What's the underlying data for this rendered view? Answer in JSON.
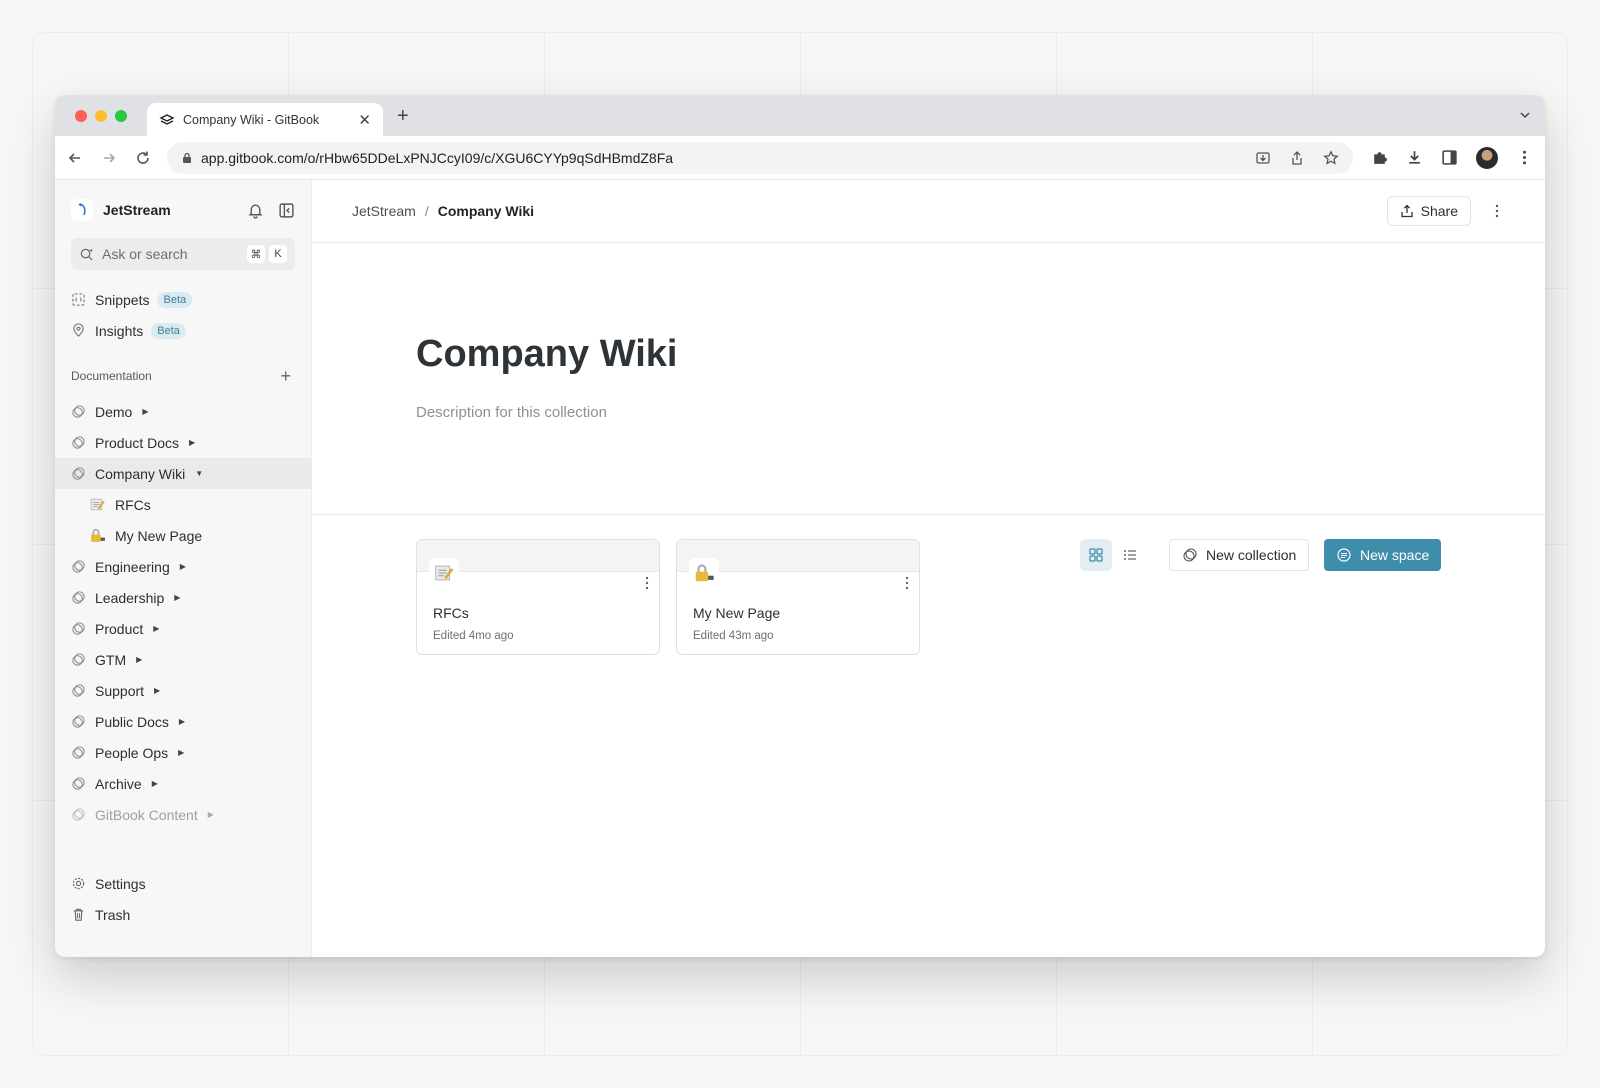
{
  "browser": {
    "tab_title": "Company Wiki - GitBook",
    "url": "app.gitbook.com/o/rHbw65DDeLxPNJCcyI09/c/XGU6CYYp9qSdHBmdZ8Fa",
    "traffic_colors": [
      "#fe5f57",
      "#febc2e",
      "#28c840"
    ]
  },
  "sidebar": {
    "org_name": "JetStream",
    "search_placeholder": "Ask or search",
    "search_kbd": [
      "⌘",
      "K"
    ],
    "top_items": [
      {
        "label": "Snippets",
        "badge": "Beta"
      },
      {
        "label": "Insights",
        "badge": "Beta"
      }
    ],
    "section_title": "Documentation",
    "tree": [
      {
        "label": "Demo"
      },
      {
        "label": "Product Docs"
      },
      {
        "label": "Company Wiki"
      },
      {
        "label": "RFCs"
      },
      {
        "label": "My New Page"
      },
      {
        "label": "Engineering"
      },
      {
        "label": "Leadership"
      },
      {
        "label": "Product"
      },
      {
        "label": "GTM"
      },
      {
        "label": "Support"
      },
      {
        "label": "Public Docs"
      },
      {
        "label": "People Ops"
      },
      {
        "label": "Archive"
      },
      {
        "label": "GitBook Content"
      }
    ],
    "bottom_items": [
      {
        "label": "Settings"
      },
      {
        "label": "Trash"
      }
    ]
  },
  "main": {
    "breadcrumb_root": "JetStream",
    "breadcrumb_sep": "/",
    "breadcrumb_current": "Company Wiki",
    "share_label": "Share",
    "title": "Company Wiki",
    "description": "Description for this collection",
    "new_collection_label": "New collection",
    "new_space_label": "New space",
    "accent_color": "#3e8eab",
    "cards": [
      {
        "title": "RFCs",
        "meta": "Edited 4mo ago",
        "emoji": "memo-icon"
      },
      {
        "title": "My New Page",
        "meta": "Edited 43m ago",
        "emoji": "lock-with-key-icon"
      }
    ]
  }
}
